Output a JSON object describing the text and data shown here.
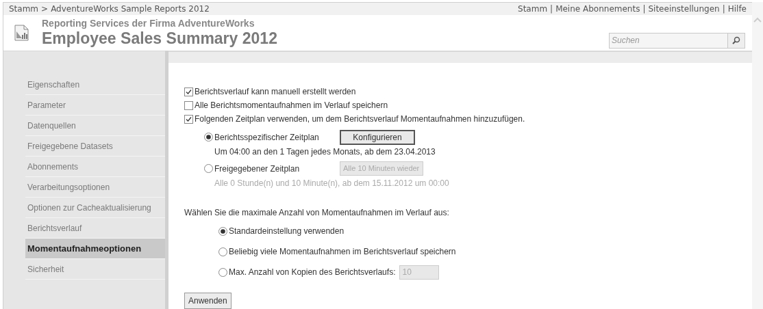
{
  "breadcrumb": {
    "items": [
      "Stamm",
      "AdventureWorks Sample Reports 2012"
    ],
    "separator": ">"
  },
  "top_links": {
    "items": [
      "Stamm",
      "Meine Abonnements",
      "Siteeinstellungen",
      "Hilfe"
    ],
    "separator": "|"
  },
  "header": {
    "subtitle": "Reporting Services der Firma AdventureWorks",
    "title": "Employee Sales Summary 2012"
  },
  "search": {
    "placeholder": "Suchen"
  },
  "sidebar": {
    "items": [
      {
        "label": "Eigenschaften",
        "selected": false
      },
      {
        "label": "Parameter",
        "selected": false
      },
      {
        "label": "Datenquellen",
        "selected": false
      },
      {
        "label": "Freigegebene Datasets",
        "selected": false
      },
      {
        "label": "Abonnements",
        "selected": false
      },
      {
        "label": "Verarbeitungsoptionen",
        "selected": false
      },
      {
        "label": "Optionen zur Cacheaktualisierung",
        "selected": false
      },
      {
        "label": "Berichtsverlauf",
        "selected": false
      },
      {
        "label": "Momentaufnahmeoptionen",
        "selected": true
      },
      {
        "label": "Sicherheit",
        "selected": false
      }
    ]
  },
  "history_options": [
    {
      "label": "Berichtsverlauf kann manuell erstellt werden",
      "checked": true
    },
    {
      "label": "Alle Berichtsmomentaufnahmen im Verlauf speichern",
      "checked": false
    },
    {
      "label": "Folgenden Zeitplan verwenden, um dem Berichtsverlauf Momentaufnahmen hinzuzufügen.",
      "checked": true
    }
  ],
  "schedule_options": [
    {
      "kind": "button",
      "label": "Berichtsspezifischer Zeitplan",
      "selected": true,
      "control": "Konfigurieren",
      "disabled": false,
      "description": "Um 04:00 an den 1 Tagen jedes Monats, ab dem 23.04.2013"
    },
    {
      "kind": "select",
      "label": "Freigegebener Zeitplan",
      "selected": false,
      "control": "Alle 10 Minuten wieder",
      "disabled": true,
      "description": "Alle 0 Stunde(n) und 10 Minute(n), ab dem 15.11.2012 um 00:00"
    }
  ],
  "max_snapshots": {
    "label": "Wählen Sie die maximale Anzahl von Momentaufnahmen im Verlauf aus:",
    "options": [
      {
        "kind": "plain",
        "label": "Standardeinstellung verwenden",
        "selected": true
      },
      {
        "kind": "plain",
        "label": "Beliebig viele Momentaufnahmen im Berichtsverlauf speichern",
        "selected": false
      },
      {
        "kind": "input",
        "label": "Max. Anzahl von Kopien des Berichtsverlaufs:",
        "selected": false,
        "value": "10",
        "disabled": true
      }
    ]
  },
  "apply_button": "Anwenden"
}
